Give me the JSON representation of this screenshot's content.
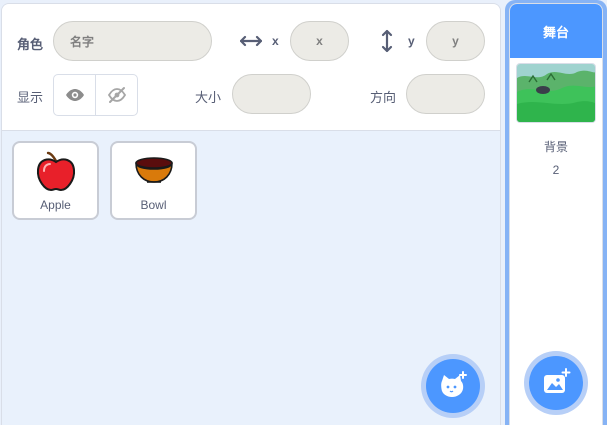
{
  "sprite_info": {
    "sprite_label": "角色",
    "name_placeholder": "名字",
    "x_label": "x",
    "x_placeholder": "x",
    "y_label": "y",
    "y_placeholder": "y",
    "show_label": "显示",
    "size_label": "大小",
    "direction_label": "方向",
    "size_value": "",
    "direction_value": ""
  },
  "sprites": [
    {
      "name": "Apple",
      "icon": "apple-icon"
    },
    {
      "name": "Bowl",
      "icon": "bowl-icon"
    }
  ],
  "stage": {
    "title": "舞台",
    "backdrop_label": "背景",
    "backdrop_count": "2"
  },
  "buttons": {
    "add_sprite_icon": "cat-plus-icon",
    "add_backdrop_icon": "image-plus-icon"
  },
  "colors": {
    "accent": "#4c97ff",
    "accent_light": "#b7cff7",
    "text": "#575e75",
    "pill_bg": "#ecebe6"
  }
}
